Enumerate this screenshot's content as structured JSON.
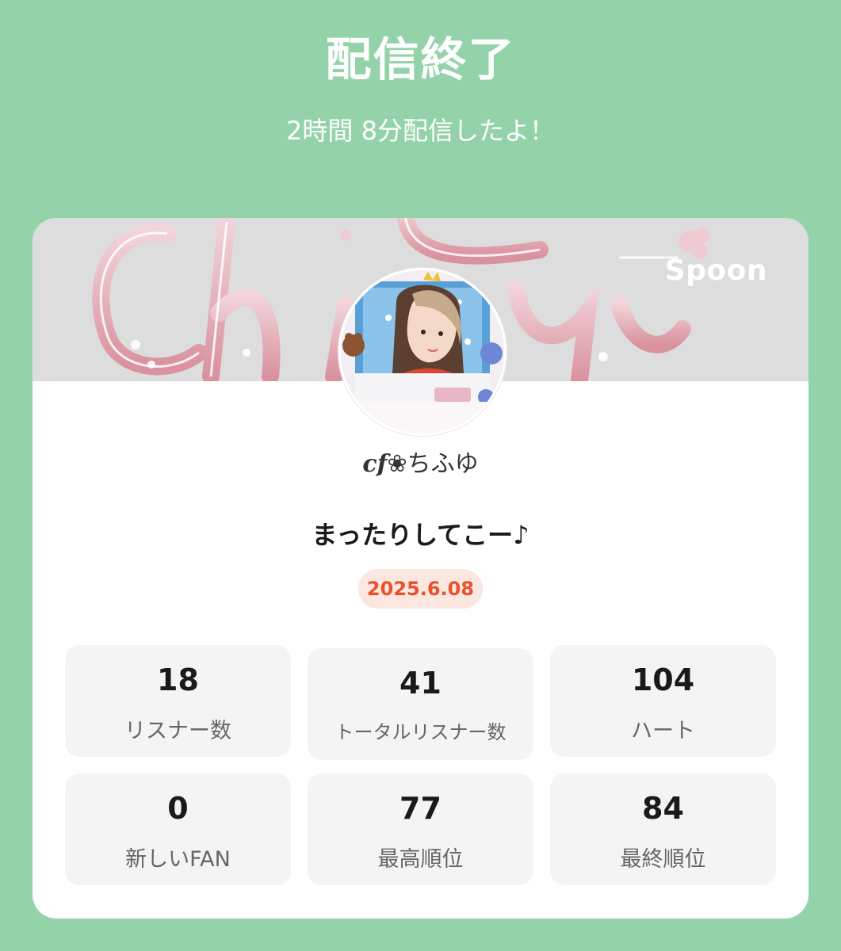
{
  "header": {
    "title": "配信終了",
    "duration_text": "2時間 8分配信したよ！"
  },
  "card": {
    "brand": "Spoon",
    "user": {
      "name_prefix": "cf",
      "name_symbol": "❀",
      "name": "ちふゆ"
    },
    "stream_title": "まったりしてこー♪",
    "date": "2025.6.08",
    "colors": {
      "background": "#94d3a9",
      "date_badge_bg": "#fbe6e0",
      "date_badge_text": "#e8502e",
      "stat_tile_bg": "#f4f4f4"
    },
    "stats": [
      {
        "value": "18",
        "label": "リスナー数"
      },
      {
        "value": "41",
        "label": "トータルリスナー数"
      },
      {
        "value": "104",
        "label": "ハート"
      },
      {
        "value": "0",
        "label": "新しいFAN"
      },
      {
        "value": "77",
        "label": "最高順位"
      },
      {
        "value": "84",
        "label": "最終順位"
      }
    ]
  }
}
